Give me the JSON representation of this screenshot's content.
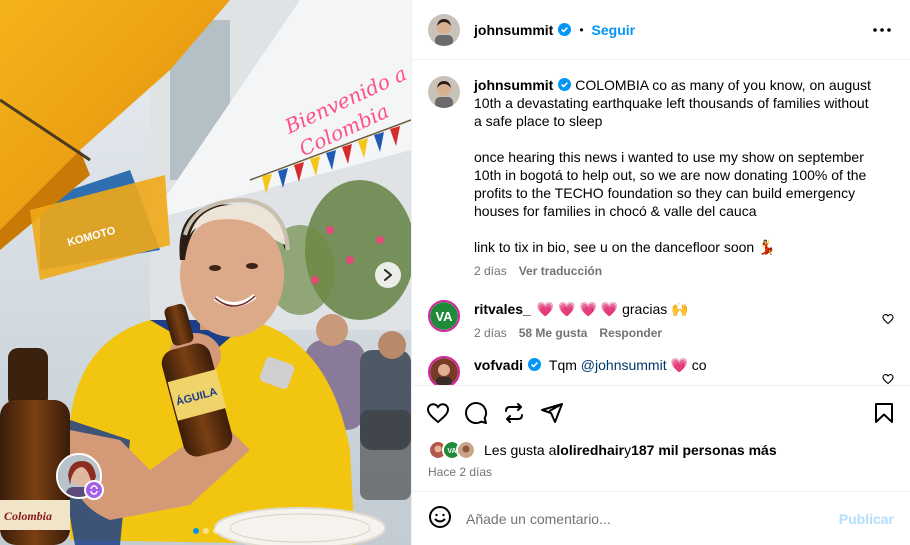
{
  "post": {
    "author": "johnsummit",
    "follow_label": "Seguir",
    "separator": "•",
    "more_label": "•••"
  },
  "caption": {
    "username": "johnsummit",
    "paragraphs": [
      "COLOMBIA co as many of you know, on august 10th a devastating earthquake left thousands of families without a safe place to sleep",
      "once hearing this news i wanted to use my show on september 10th in bogotá to help out, so we are now donating 100% of the profits to the TECHO foundation so they can build emergency houses for families in chocó & valle del cauca",
      "link to tix in bio, see u on the dancefloor soon 💃"
    ],
    "time": "2 días",
    "translate_label": "Ver traducción"
  },
  "comments": [
    {
      "username": "ritvales_",
      "text": "💗 💗 💗 💗 gracias 🙌",
      "time": "2 días",
      "likes": "58 Me gusta",
      "reply_label": "Responder"
    },
    {
      "username": "vofvadi",
      "text_prefix": "Tqm ",
      "mention": "@johnsummit",
      "text_suffix": " 💗 co"
    }
  ],
  "likes": {
    "prefix": "Les gusta a ",
    "user": "loliredhair",
    "middle": " y ",
    "count": "187 mil personas más"
  },
  "posted_ago": "Hace 2 días",
  "add_comment": {
    "placeholder": "Añade un comentario...",
    "publish_label": "Publicar"
  },
  "photo": {
    "neon_sign_line1": "Bienvenido a",
    "neon_sign_line2": "Colombia",
    "bottle_label": "ÁGUILA",
    "left_bottle_label": "Colombia",
    "restaurant_sign": "KOMOTO",
    "carousel": {
      "current": 1,
      "total": 3
    }
  },
  "colors": {
    "accent": "#0095f6",
    "muted": "#737373",
    "jersey_yellow": "#f2c511",
    "neon_pink": "#ff4f8b"
  },
  "icons": [
    "verified-badge-icon",
    "more-options-icon",
    "heart-icon",
    "comment-icon",
    "share-icon",
    "send-icon",
    "bookmark-icon",
    "emoji-icon",
    "chevron-right-icon",
    "collab-icon"
  ]
}
